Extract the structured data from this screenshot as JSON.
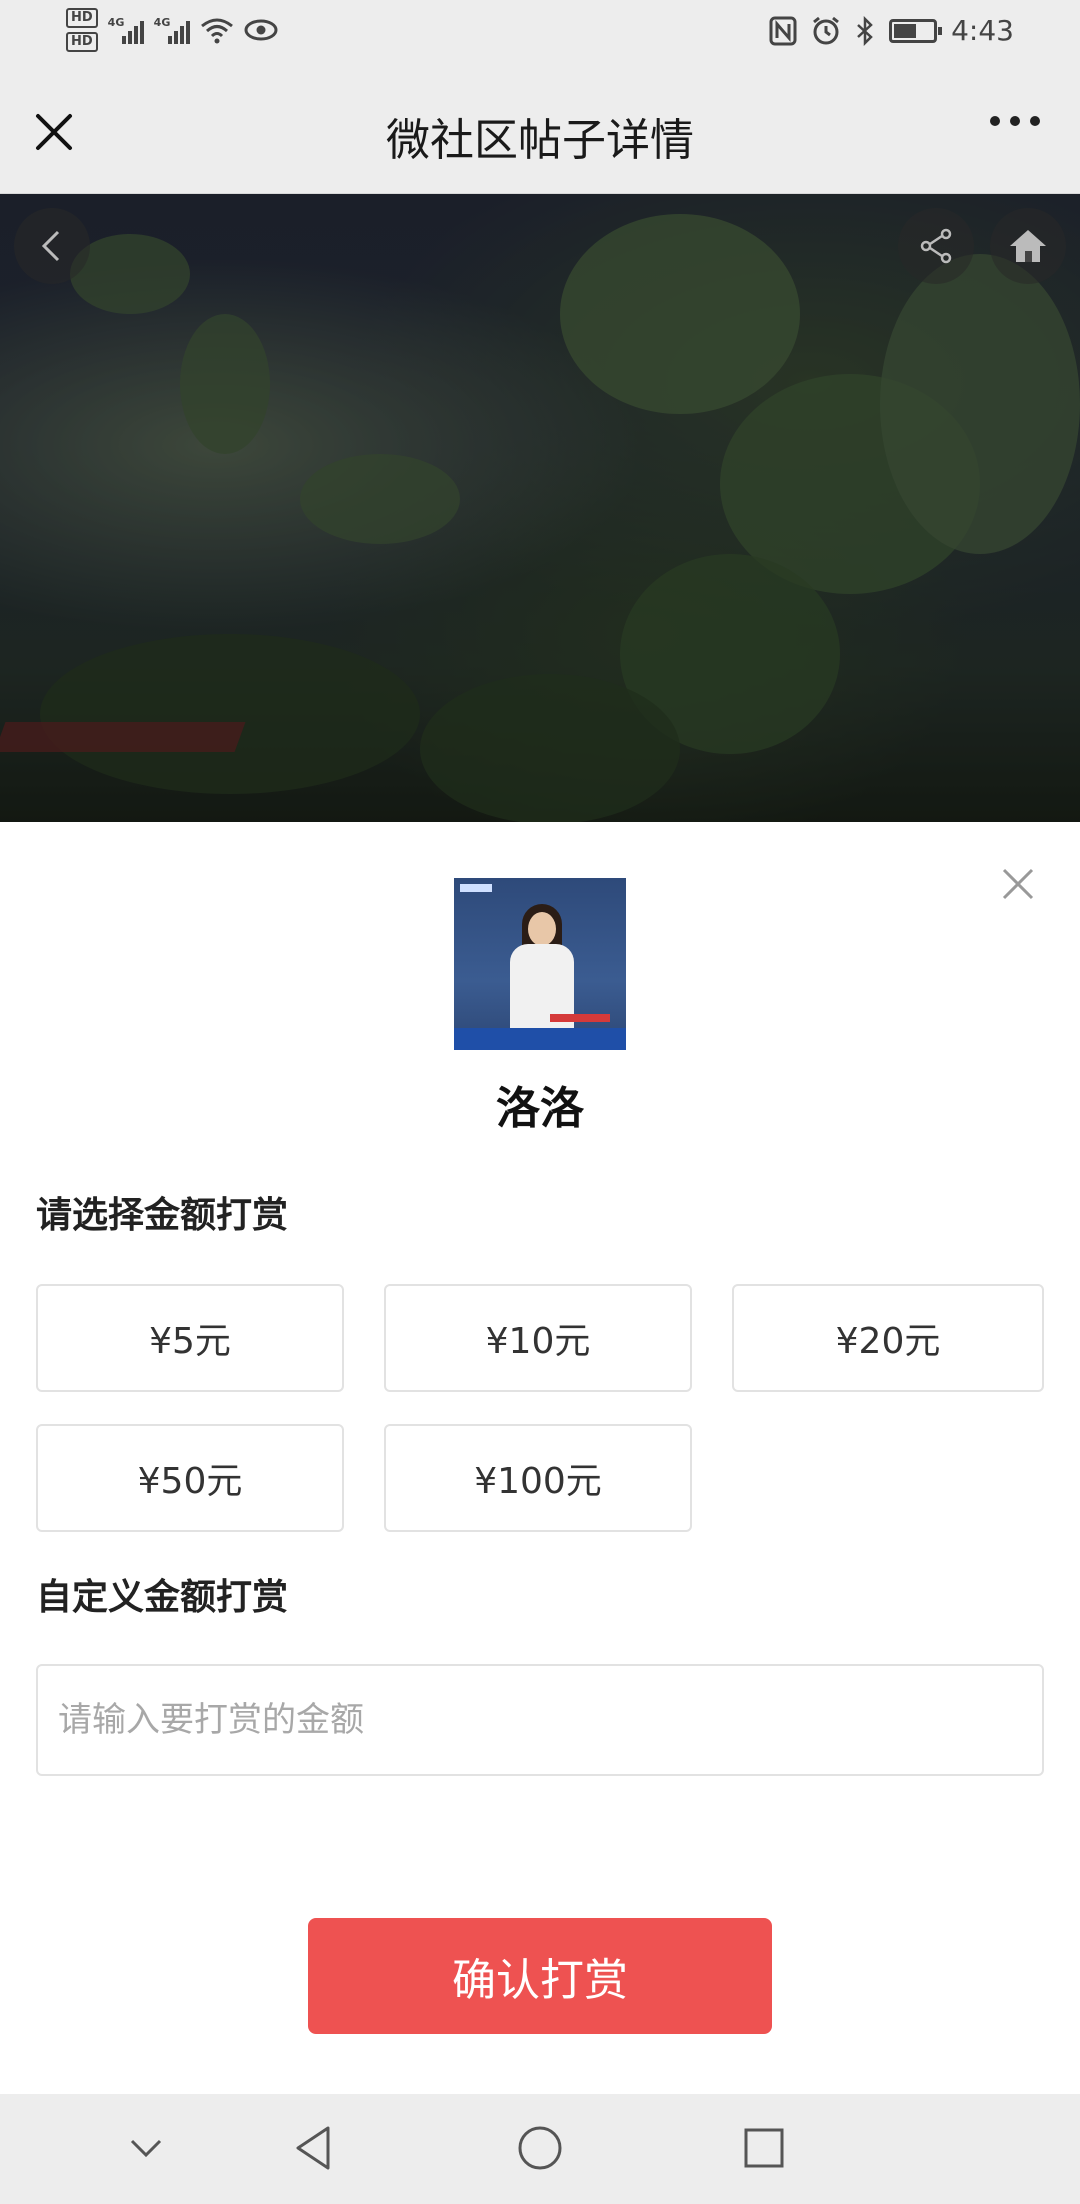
{
  "status_bar": {
    "hd_badge_1": "HD",
    "hd_badge_2": "HD",
    "net_1": "4G",
    "net_2": "4G",
    "time": "4:43"
  },
  "nav": {
    "title": "微社区帖子详情"
  },
  "photo_icons": [
    "back-icon",
    "share-icon",
    "home-icon"
  ],
  "reward": {
    "author_name": "洛洛",
    "choose_title": "请选择金额打赏",
    "amounts": [
      "¥5元",
      "¥10元",
      "¥20元",
      "¥50元",
      "¥100元"
    ],
    "custom_title": "自定义金额打赏",
    "custom_placeholder": "请输入要打赏的金额",
    "confirm_label": "确认打赏"
  },
  "colors": {
    "accent": "#ee5251",
    "background": "#ededed"
  }
}
